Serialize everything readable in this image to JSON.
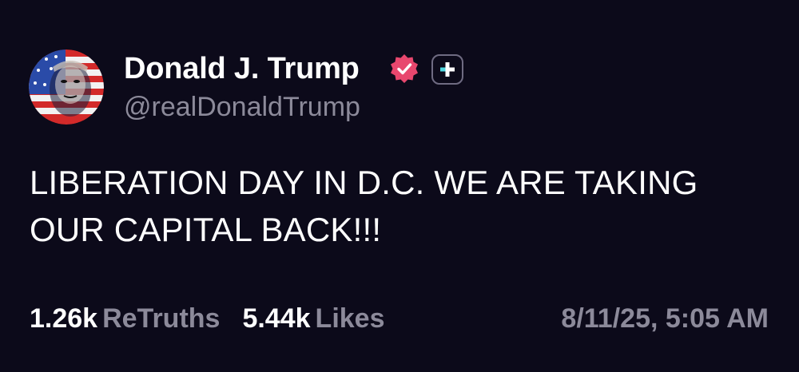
{
  "post": {
    "author": {
      "display_name": "Donald J. Trump",
      "handle": "@realDonaldTrump",
      "verified_icon": "verified-badge-icon",
      "plus_icon": "plus-badge-icon"
    },
    "text": "LIBERATION DAY IN D.C. WE ARE TAKING OUR CAPITAL BACK!!!",
    "stats": {
      "retruths_count": "1.26k",
      "retruths_label": "ReTruths",
      "likes_count": "5.44k",
      "likes_label": "Likes"
    },
    "timestamp": "8/11/25, 5:05 AM"
  },
  "colors": {
    "background": "#0c0a1a",
    "text_primary": "#ffffff",
    "text_secondary": "#8c8a9a",
    "verified_badge": "#e8476e",
    "plus_accent": "#4fd8e0"
  }
}
